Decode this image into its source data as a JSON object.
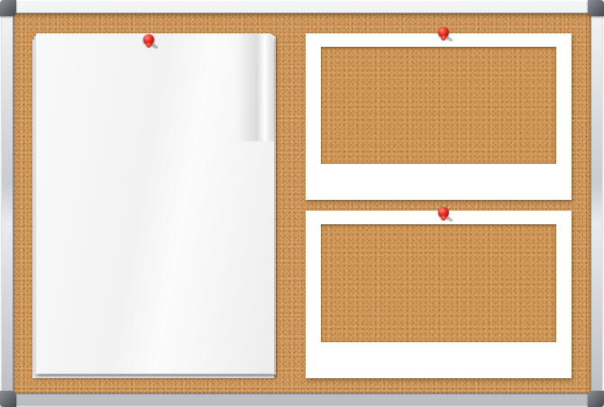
{
  "board": {
    "frame_color": "#c9ccd0",
    "cork_color": "#d39c5e",
    "corner_color": "#5a5e63"
  },
  "items": [
    {
      "kind": "paper-stack",
      "color": "#f7f7f7"
    },
    {
      "kind": "photo-frame",
      "color": "#ffffff"
    },
    {
      "kind": "photo-frame",
      "color": "#ffffff"
    }
  ],
  "pins": [
    {
      "icon": "pushpin-icon",
      "color": "#e0261d"
    },
    {
      "icon": "pushpin-icon",
      "color": "#e0261d"
    },
    {
      "icon": "pushpin-icon",
      "color": "#e0261d"
    }
  ]
}
